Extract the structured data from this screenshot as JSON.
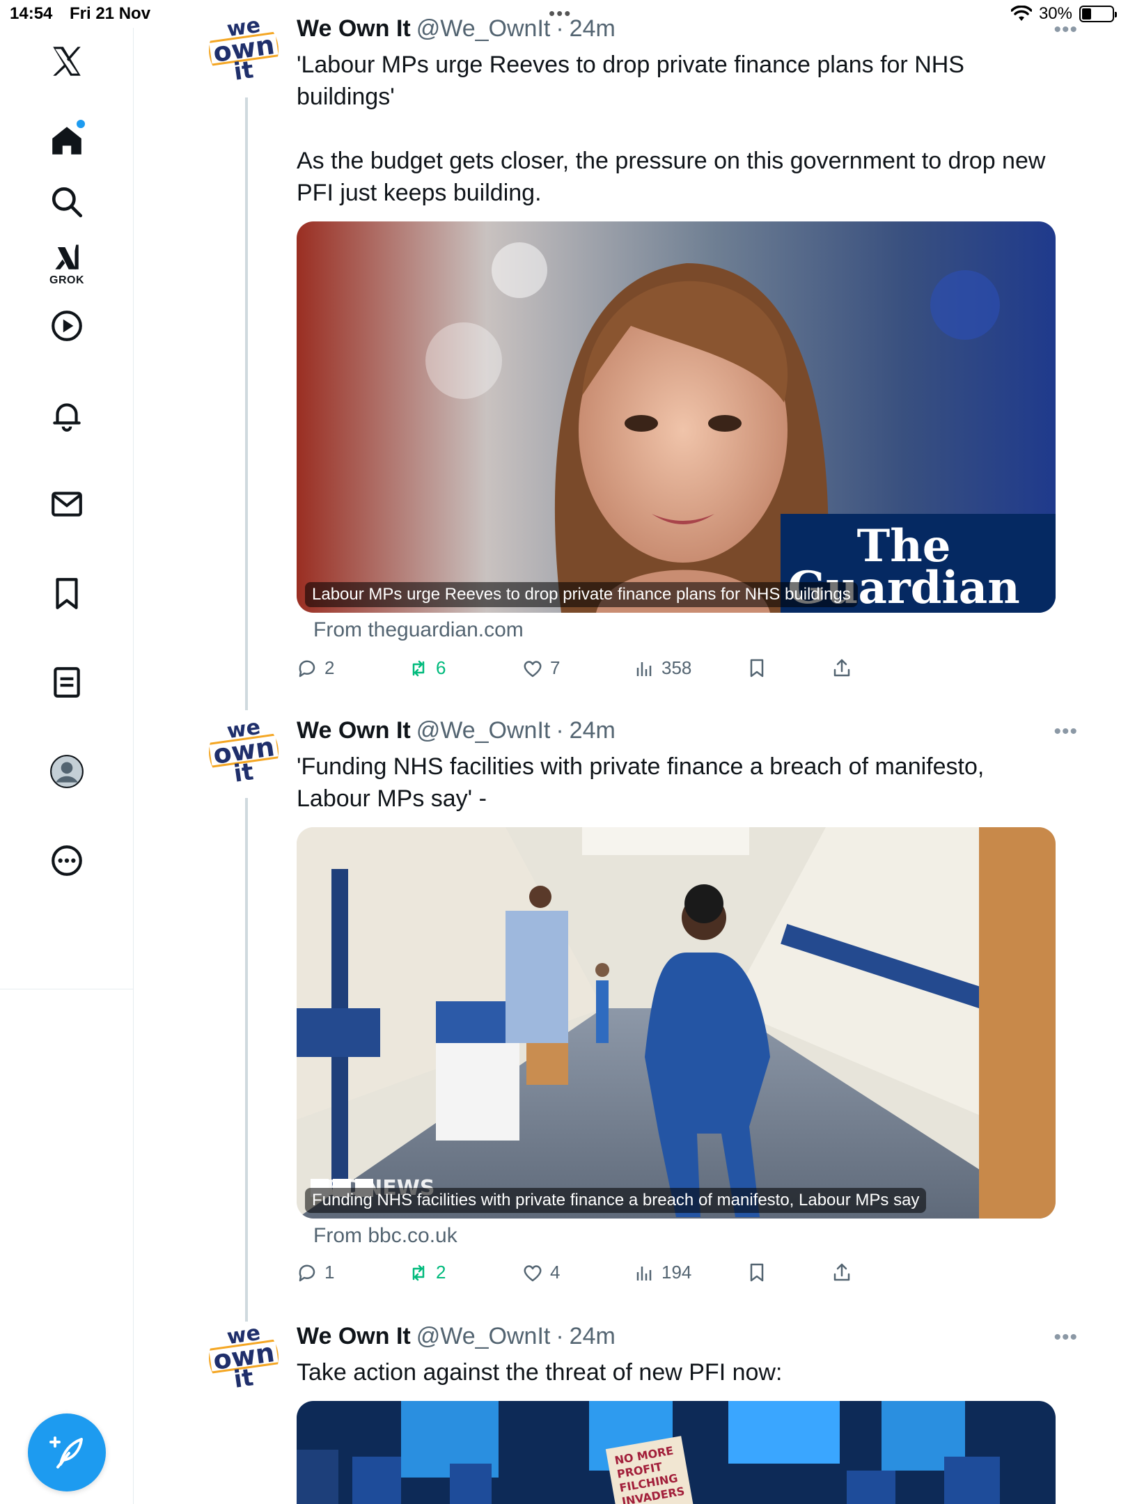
{
  "status_bar": {
    "time": "14:54",
    "date": "Fri 21 Nov",
    "battery": "30%",
    "battery_level": 0.3
  },
  "sidebar": {
    "items": [
      {
        "name": "x-logo-icon"
      },
      {
        "name": "home-icon",
        "has_notification_dot": true
      },
      {
        "name": "search-icon"
      },
      {
        "name": "grok-icon",
        "label": "GROK"
      },
      {
        "name": "video-icon"
      },
      {
        "name": "bell-icon"
      },
      {
        "name": "mail-icon"
      },
      {
        "name": "bookmark-icon"
      },
      {
        "name": "lists-icon"
      },
      {
        "name": "profile-icon"
      },
      {
        "name": "more-icon"
      }
    ],
    "compose_button": "compose-icon"
  },
  "colors": {
    "accent": "#1d9bf0",
    "retweet": "#00ba7c",
    "secondary_text": "#536471",
    "guardian_blue": "#052962"
  },
  "tweets": [
    {
      "author": "We Own It",
      "handle": "@We_OwnIt",
      "dot": "·",
      "time": "24m",
      "avatar_lines": [
        "we",
        "own",
        "it"
      ],
      "text": "'Labour MPs urge Reeves to drop private finance plans for NHS buildings'\n\nAs the budget gets closer, the pressure on this government to drop new PFI just keeps building.",
      "card": {
        "caption": "Labour MPs urge Reeves to drop private finance plans for NHS buildings",
        "source": "From theguardian.com",
        "brand_line1": "The",
        "brand_line2": "Guardian"
      },
      "actions": {
        "replies": "2",
        "reposts": "6",
        "likes": "7",
        "views": "358"
      }
    },
    {
      "author": "We Own It",
      "handle": "@We_OwnIt",
      "dot": "·",
      "time": "24m",
      "avatar_lines": [
        "we",
        "own",
        "it"
      ],
      "text": "'Funding NHS facilities with private finance a breach of manifesto, Labour MPs say' -",
      "card": {
        "caption": "Funding NHS facilities with private finance a breach of manifesto, Labour MPs say",
        "source": "From bbc.co.uk",
        "brand_line1": "BBC NEWS"
      },
      "actions": {
        "replies": "1",
        "reposts": "2",
        "likes": "4",
        "views": "194"
      }
    },
    {
      "author": "We Own It",
      "handle": "@We_OwnIt",
      "dot": "·",
      "time": "24m",
      "avatar_lines": [
        "we",
        "own",
        "it"
      ],
      "text": "Take action against the threat of new PFI now:",
      "card": {
        "placard_text": [
          "NO MORE",
          "PROFIT",
          "FILCHING",
          "INVADERS"
        ]
      }
    }
  ]
}
